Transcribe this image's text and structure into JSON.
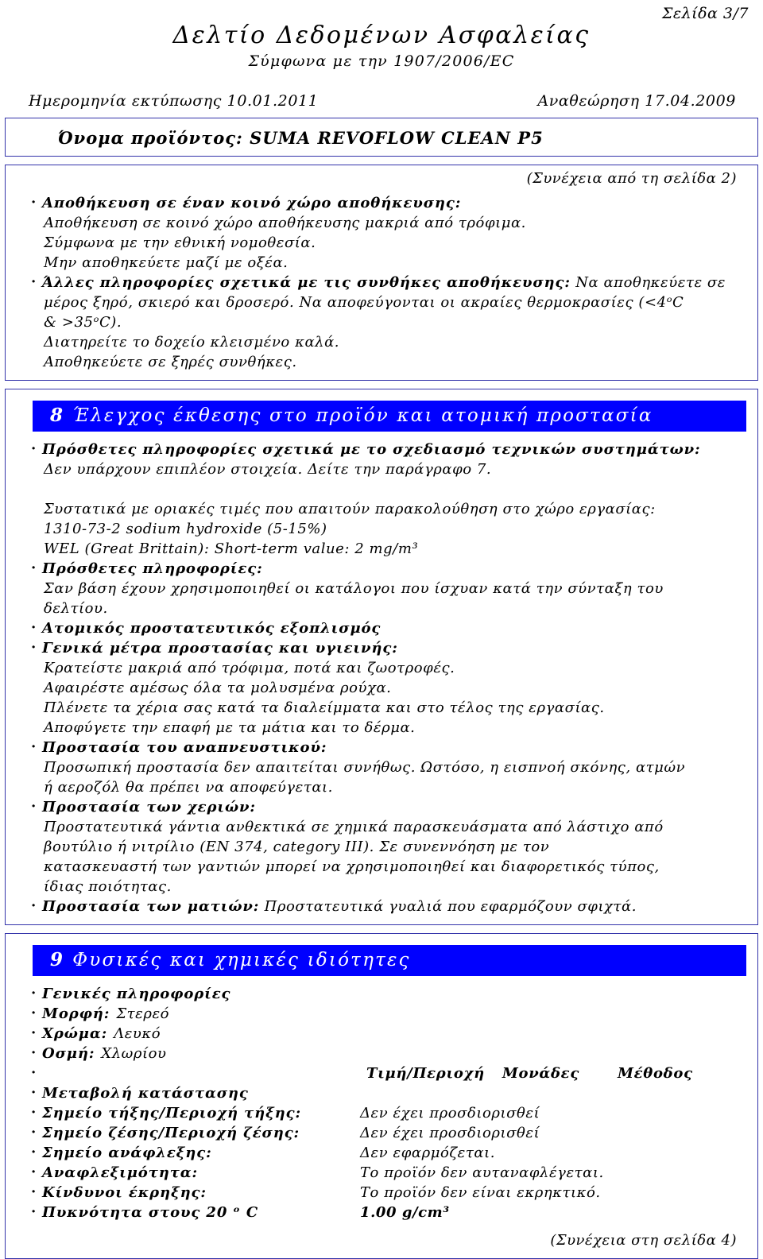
{
  "header": {
    "page_number": "Σελίδα 3/7",
    "title": "Δελτίο Δεδομένων Ασφαλείας",
    "subtitle": "Σύμφωνα με την 1907/2006/EC",
    "print_date": "Ημερομηνία εκτύπωσης 10.01.2011",
    "revision": "Αναθεώρηση 17.04.2009"
  },
  "product": {
    "label": "Όνομα προϊόντος:",
    "name": "SUMA REVOFLOW CLEAN P5"
  },
  "continuation": {
    "from": "(Συνέχεια από τη σελίδα 2)",
    "to": "(Συνέχεια στη σελίδα 4)"
  },
  "storage": {
    "heading": "Αποθήκευση σε έναν κοινό χώρο αποθήκευσης:",
    "lines": [
      "Αποθήκευση σε κοινό χώρο αποθήκευσης μακριά από τρόφιμα.",
      "Σύμφωνα με την εθνική νομοθεσία.",
      "Μην αποθηκεύετε μαζί με οξέα."
    ],
    "other_heading": "Άλλες πληροφορίες σχετικά με τις συνθήκες αποθήκευσης:",
    "other_first_value": "Να αποθηκεύετε σε",
    "other_lines": [
      "μέρος ξηρό, σκιερό και δροσερό. Να αποφεύγονται οι ακραίες θερμοκρασίες (<4ᵒC",
      "& >35ᵒC).",
      "Διατηρείτε το δοχείο κλεισμένο καλά.",
      "Αποθηκεύετε σε ξηρές συνθήκες."
    ]
  },
  "section8": {
    "number": "8",
    "title": "Έλεγχος έκθεσης στο προϊόν και ατομική προστασία",
    "tech_heading": "Πρόσθετες πληροφορίες σχετικά με το σχεδιασμό τεχνικών συστημάτων:",
    "tech_line": "Δεν υπάρχουν επιπλέον στοιχεία. Δείτε την παράγραφο 7.",
    "limits_intro": "Συστατικά με οριακές τιμές που απαιτούν παρακολούθηση στο χώρο εργασίας:",
    "limits_cas": "1310-73-2 sodium hydroxide (5-15%)",
    "limits_wel": "WEL (Great Brittain): Short-term value: 2 mg/m³",
    "addinfo_heading": "Πρόσθετες πληροφορίες:",
    "addinfo_lines": [
      "Σαν βάση έχουν χρησιμοποιηθεί οι κατάλογοι που ίσχυαν κατά την σύνταξη του",
      "δελτίου."
    ],
    "ppe_heading": "Ατομικός προστατευτικός εξοπλισμός",
    "general_heading": "Γενικά μέτρα προστασίας και υγιεινής:",
    "general_lines": [
      "Κρατείστε μακριά από τρόφιμα, ποτά και ζωοτροφές.",
      "Αφαιρέστε αμέσως όλα τα μολυσμένα ρούχα.",
      "Πλένετε τα χέρια σας κατά τα διαλείμματα και στο τέλος της εργασίας.",
      "Αποφύγετε την επαφή με τα μάτια και το δέρμα."
    ],
    "resp_heading": "Προστασία του αναπνευστικού:",
    "resp_lines": [
      "Προσωπική προστασία δεν απαιτείται συνήθως. Ωστόσο, η εισπνοή σκόνης, ατμών",
      "ή αεροζόλ θα πρέπει να αποφεύγεται."
    ],
    "hands_heading": "Προστασία των χεριών:",
    "hands_lines": [
      "Προστατευτικά γάντια ανθεκτικά σε χημικά παρασκευάσματα από λάστιχο από",
      "βουτύλιο ή νιτρίλιο (EN 374, category III). Σε συνεννόηση με τον",
      "κατασκευαστή των γαντιών μπορεί να χρησιμοποιηθεί και διαφορετικός τύπος,",
      "ίδιας ποιότητας."
    ],
    "eyes_heading": "Προστασία των ματιών:",
    "eyes_value": "Προστατευτικά γυαλιά που εφαρμόζουν σφιχτά."
  },
  "section9": {
    "number": "9",
    "title": "Φυσικές και χημικές ιδιότητες",
    "general_heading": "Γενικές πληροφορίες",
    "basic": [
      {
        "key": "Μορφή:",
        "value": "Στερεό"
      },
      {
        "key": "Χρώμα:",
        "value": "Λευκό"
      },
      {
        "key": "Οσμή:",
        "value": "Χλωρίου"
      }
    ],
    "table_headers": {
      "value_range": "Τιμή/Περιοχή",
      "units": "Μονάδες",
      "method": "Μέθοδος"
    },
    "state_change_heading": "Μεταβολή κατάστασης",
    "rows": [
      {
        "key": "Σημείο τήξης/Περιοχή τήξης:",
        "value": "Δεν έχει προσδιορισθεί",
        "bold": false
      },
      {
        "key": "Σημείο ζέσης/Περιοχή ζέσης:",
        "value": "Δεν έχει προσδιορισθεί",
        "bold": false
      },
      {
        "key": "Σημείο ανάφλεξης:",
        "value": "Δεν εφαρμόζεται.",
        "bold": false
      },
      {
        "key": "Αναφλεξιμότητα:",
        "value": "Το προϊόν δεν αυταναφλέγεται.",
        "bold": false
      },
      {
        "key": "Κίνδυνοι έκρηξης:",
        "value": "Το προϊόν δεν είναι εκρηκτικό.",
        "bold": false
      },
      {
        "key": "Πυκνότητα     στους  20 ᵒ C",
        "value": "1.00 g/cm³",
        "bold": true
      }
    ]
  },
  "colors": {
    "section_bar_bg": "#0000ff",
    "section_bar_text": "#ffffff",
    "frame_border": "#3333aa",
    "text": "#000000"
  }
}
